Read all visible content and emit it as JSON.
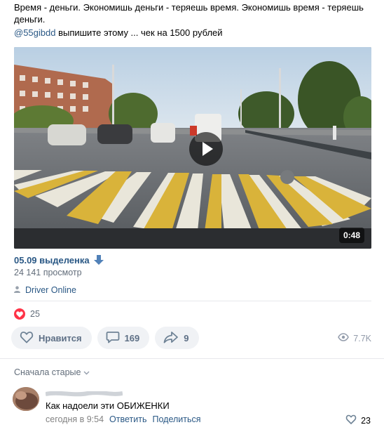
{
  "post": {
    "text": "Время - деньги. Экономишь деньги - теряешь время. Экономишь время - теряешь деньги.",
    "mention": "@55gibdd",
    "mention_rest": " выпишите этому ... чек на 1500 рублей"
  },
  "video": {
    "duration": "0:48",
    "title": "05.09 выделенка",
    "views": "24 141 просмотр",
    "channel": "Driver Online"
  },
  "reactions": {
    "likes": "25"
  },
  "actions": {
    "like_label": "Нравится",
    "comments_count": "169",
    "shares_count": "9",
    "views_count": "7.7K"
  },
  "comments": {
    "sort_label": "Сначала старые",
    "items": [
      {
        "text": "Как надоели эти ОБИЖЕНКИ",
        "time": "сегодня в 9:54",
        "reply_label": "Ответить",
        "share_label": "Поделиться",
        "likes": "23"
      }
    ]
  },
  "colors": {
    "link": "#2a5885",
    "like_red": "#ff3347",
    "button_bg": "#f0f2f5",
    "muted": "#626d7a"
  }
}
